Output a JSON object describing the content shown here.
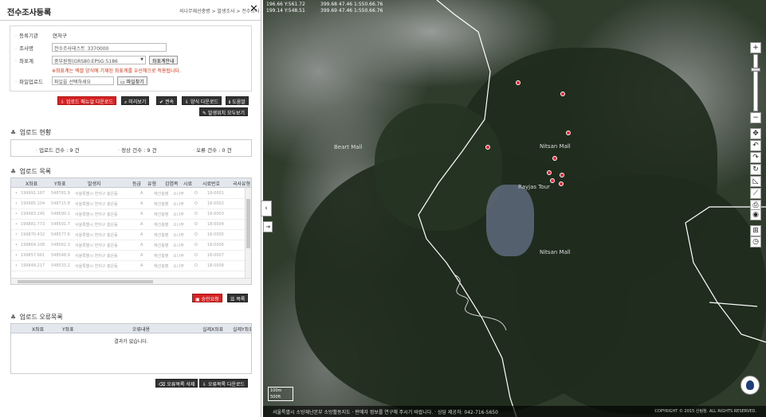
{
  "header": {
    "title": "전수조사등록",
    "breadcrumb": "쇠나무재선충병 > 발생조사 > 전수조사"
  },
  "form": {
    "org_label": "등록기관",
    "org_value": "연저구",
    "name_label": "조사명",
    "name_value": "전수조사테스트_3370000",
    "crs_label": "좌표계",
    "crs_value": "중부원점(GRS80:EPSG:5186",
    "crs_button": "좌표계안내",
    "note": "※좌표계는 엑셀 양식에 기재된 좌표계를 우선해으로 적용됩니다.",
    "file_label": "파일업로드",
    "file_placeholder": "파일을 선택하세요",
    "file_button": "파일찾기"
  },
  "actions": {
    "download_manual": "업로드 매뉴얼 다운로드",
    "preview": "미리보기",
    "confirm": "권속",
    "template_download": "양식 다운로드",
    "help": "도움말",
    "show_all": "발생위치 모두보기"
  },
  "upload_status": {
    "title": "업로드 현황",
    "upload_count": "업로드 건수 : 9 건",
    "ok_count": "정상 건수 : 9 건",
    "error_count": "오류 건수 : 0 건"
  },
  "upload_list": {
    "title": "업로드 목록",
    "columns": [
      "X좌표",
      "Y좌표",
      "발생지",
      "등급",
      "유형",
      "감염목",
      "시료",
      "시료번호",
      "국사유형"
    ],
    "rows": [
      [
        "199991.187",
        "548781.9",
        "서울특별시 연저구 홍은동",
        "A",
        "재선충병",
        "소나무",
        "O",
        "18-0001",
        ""
      ],
      [
        "199985.104",
        "548715.8",
        "서울특별시 연저구 홍은동",
        "A",
        "재선충병",
        "소나무",
        "O",
        "18-0002",
        ""
      ],
      [
        "199983.245",
        "548690.1",
        "서울특별시 연저구 홍은동",
        "A",
        "재선충병",
        "소나무",
        "O",
        "18-0003",
        ""
      ],
      [
        "199881.773",
        "548591.7",
        "서울특별시 연저구 홍은동",
        "A",
        "재선충병",
        "소나무",
        "O",
        "18-0004",
        ""
      ],
      [
        "199870.432",
        "548577.6",
        "서울특별시 연저구 홍은동",
        "A",
        "재선충병",
        "소나무",
        "O",
        "18-0005",
        ""
      ],
      [
        "199864.108",
        "548562.3",
        "서울특별시 연저구 홍은동",
        "A",
        "재선충병",
        "소나무",
        "O",
        "18-0006",
        ""
      ],
      [
        "199857.661",
        "548548.9",
        "서울특별시 연저구 홍은동",
        "A",
        "재선충병",
        "소나무",
        "O",
        "18-0007",
        ""
      ],
      [
        "199849.217",
        "548533.2",
        "서울특별시 연저구 홍은동",
        "A",
        "재선충병",
        "소나무",
        "O",
        "18-0008",
        ""
      ]
    ],
    "approve_button": "승인요청",
    "list_button": "목록"
  },
  "error_list": {
    "title": "업로드 오류목록",
    "columns": [
      "X좌표",
      "Y좌표",
      "오류내용",
      "실제X좌표",
      "실제Y좌표"
    ],
    "empty_text": "결과가 없습니다.",
    "delete_button": "오류목록 삭제",
    "download_button": "오류목록 다운로드"
  },
  "map": {
    "coords_left": "196.66 Y:561.72\n199.14 Y:548.51",
    "coords_right": "399.68 47.46 1:550.66.76\n399.69 47.46 1:550.66.76",
    "labels": [
      "Beart Mall",
      "Nitsan Mall",
      "Rayjas Tour",
      "Nitsan Mall"
    ],
    "scale_top": "100m",
    "scale_bottom": "500ft",
    "footer": "서울특별시 소방재난본부 소방활동지도 ·  판매자 정보를 연구해 주시기 바랍니다. ·  상담 제공처: 042-716-5650",
    "copyright": "COPYRIGHT © 2015 산림청. ALL RIGHTS RESERVED."
  },
  "colors": {
    "accent_red": "#d62222",
    "dark_button": "#333333",
    "boundary_line": "#ffffff",
    "point": "#ee2233"
  }
}
